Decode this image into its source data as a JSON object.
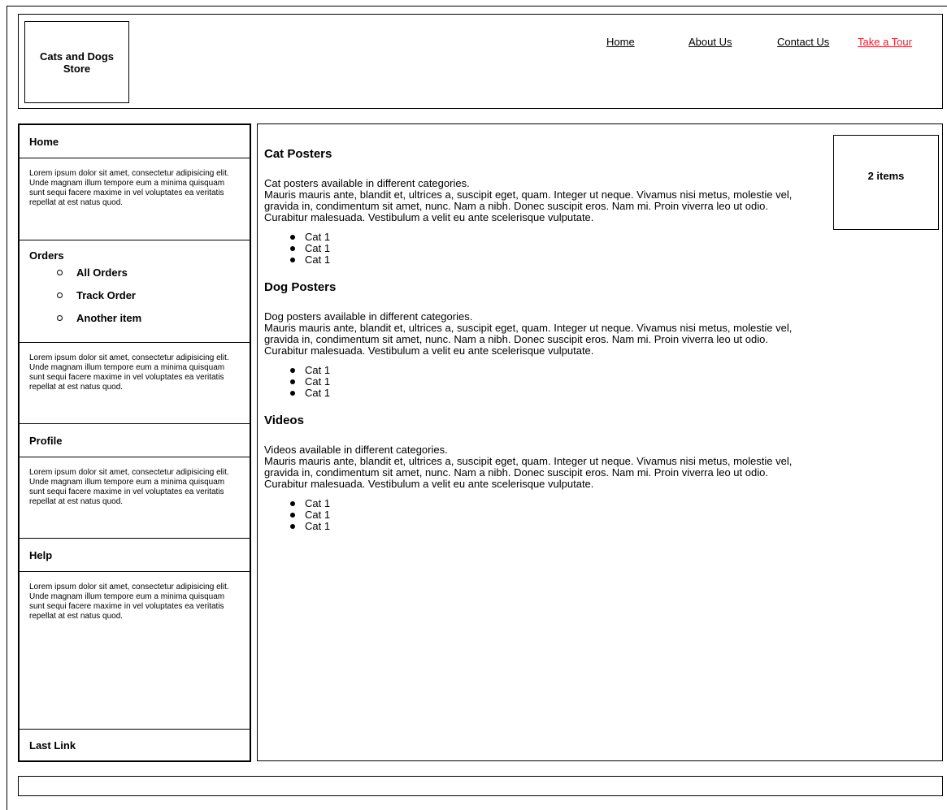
{
  "header": {
    "logo": "Cats and Dogs Store",
    "nav": [
      {
        "label": "Home"
      },
      {
        "label": "About Us"
      },
      {
        "label": "Contact Us"
      },
      {
        "label": "Take a Tour",
        "color": "#e8202f"
      }
    ]
  },
  "sidebar": {
    "home": "Home",
    "lorem": "Lorem ipsum dolor sit amet, consectetur adipisicing elit. Unde magnam illum tempore eum a minima quisquam sunt sequi facere maxime in vel voluptates ea veritatis repellat at est natus quod.",
    "orders": {
      "title": "Orders",
      "items": [
        "All Orders",
        "Track Order",
        "Another item"
      ]
    },
    "profile": "Profile",
    "help": "Help",
    "last_link": "Last Link"
  },
  "cart": {
    "label": "2 items"
  },
  "sections": [
    {
      "title": "Cat Posters",
      "intro": "Cat posters available in different categories.",
      "body": "Mauris mauris ante, blandit et, ultrices a, suscipit eget, quam. Integer ut neque. Vivamus nisi metus, molestie vel, gravida in, condimentum sit amet, nunc. Nam a nibh. Donec suscipit eros. Nam mi. Proin viverra leo ut odio. Curabitur malesuada. Vestibulum a velit eu ante scelerisque vulputate.",
      "items": [
        "Cat 1",
        "Cat 1",
        "Cat 1"
      ]
    },
    {
      "title": "Dog Posters",
      "intro": "Dog posters available in different categories.",
      "body": "Mauris mauris ante, blandit et, ultrices a, suscipit eget, quam. Integer ut neque. Vivamus nisi metus, molestie vel, gravida in, condimentum sit amet, nunc. Nam a nibh. Donec suscipit eros. Nam mi. Proin viverra leo ut odio. Curabitur malesuada. Vestibulum a velit eu ante scelerisque vulputate.",
      "items": [
        "Cat 1",
        "Cat 1",
        "Cat 1"
      ]
    },
    {
      "title": "Videos",
      "intro": "Videos available in different categories.",
      "body": "Mauris mauris ante, blandit et, ultrices a, suscipit eget, quam. Integer ut neque. Vivamus nisi metus, molestie vel, gravida in, condimentum sit amet, nunc. Nam a nibh. Donec suscipit eros. Nam mi. Proin viverra leo ut odio. Curabitur malesuada. Vestibulum a velit eu ante scelerisque vulputate.",
      "items": [
        "Cat 1",
        "Cat 1",
        "Cat 1"
      ]
    }
  ]
}
